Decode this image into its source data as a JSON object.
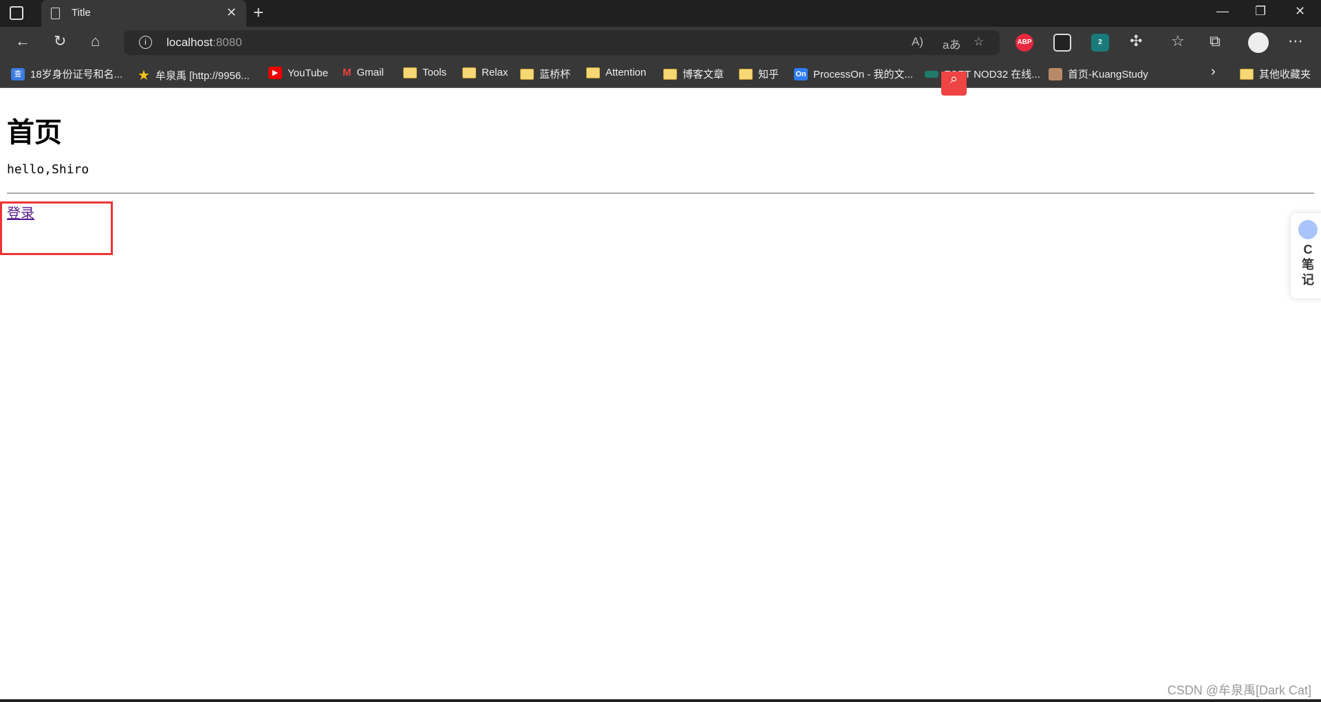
{
  "browser": {
    "tab_title": "Title",
    "address": {
      "host": "localhost",
      "port": ":8080"
    },
    "extensions": [
      {
        "name": "ABP",
        "color": "#e8283e"
      },
      {
        "name": "",
        "color": "#222"
      },
      {
        "name": "2",
        "color": "#1a7a7a"
      }
    ],
    "bookmarks": [
      {
        "label": "18岁身份证号和名...",
        "icon": "cha-icon"
      },
      {
        "label": "牟泉禹 [http://9956...",
        "icon": "star-icon"
      },
      {
        "label": "YouTube",
        "icon": "youtube-icon"
      },
      {
        "label": "Gmail",
        "icon": "gmail-icon"
      },
      {
        "label": "Tools",
        "icon": "folder-icon"
      },
      {
        "label": "Relax",
        "icon": "folder-icon"
      },
      {
        "label": "蓝桥杯",
        "icon": "folder-icon"
      },
      {
        "label": "Attention",
        "icon": "folder-icon"
      },
      {
        "label": "博客文章",
        "icon": "folder-icon"
      },
      {
        "label": "知乎",
        "icon": "folder-icon"
      },
      {
        "label": "ProcessOn - 我的文...",
        "icon": "processon-icon"
      },
      {
        "label": "ESET NOD32 在线...",
        "icon": "eset-icon"
      },
      {
        "label": "首页-KuangStudy",
        "icon": "kuang-icon"
      }
    ],
    "other_bookmarks": "其他收藏夹",
    "icons": {
      "cha": "查",
      "on": "On"
    }
  },
  "page": {
    "heading": "首页",
    "greeting": "hello,Shiro",
    "login_link": "登录"
  },
  "side_widget": {
    "letter": "C",
    "text1": "笔",
    "text2": "记"
  },
  "watermark": "CSDN @牟泉禹[Dark Cat]"
}
